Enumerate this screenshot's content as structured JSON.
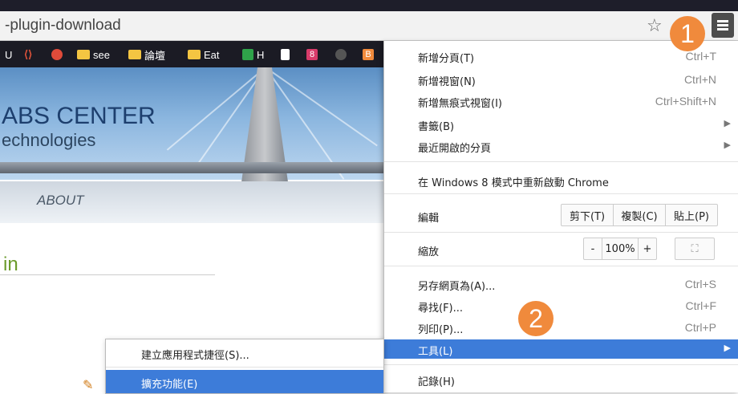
{
  "omnibox": {
    "url": "-plugin-download"
  },
  "bookmarks": [
    {
      "label": "U",
      "color": "#1b1b24"
    },
    {
      "label": "",
      "color": "#e0533a"
    },
    {
      "label": "",
      "color": "#e04b3a"
    },
    {
      "label": "see",
      "color": "#f4c542"
    },
    {
      "label": "論壇",
      "color": "#f4c542"
    },
    {
      "label": "Eat",
      "color": "#f4c542"
    },
    {
      "label": "H",
      "color": "#2fa34a"
    },
    {
      "label": "",
      "color": "#ffffff"
    },
    {
      "label": "8",
      "color": "#d83b6a"
    },
    {
      "label": "",
      "color": "#555555"
    },
    {
      "label": "B",
      "color": "#f08a3c"
    }
  ],
  "site": {
    "title": "ABS CENTER",
    "subtitle": "echnologies",
    "nav_about": "ABOUT",
    "heading": "in"
  },
  "menu": {
    "new_tab": {
      "label": "新增分頁(T)",
      "shortcut": "Ctrl+T"
    },
    "new_window": {
      "label": "新增視窗(N)",
      "shortcut": "Ctrl+N"
    },
    "incognito": {
      "label": "新增無痕式視窗(I)",
      "shortcut": "Ctrl+Shift+N"
    },
    "bookmarks": {
      "label": "書籤(B)"
    },
    "recent": {
      "label": "最近開啟的分頁"
    },
    "relaunch": {
      "label": "在 Windows 8 模式中重新啟動 Chrome"
    },
    "edit": {
      "label": "編輯",
      "cut": "剪下(T)",
      "copy": "複製(C)",
      "paste": "貼上(P)"
    },
    "zoom": {
      "label": "縮放",
      "minus": "-",
      "value": "100%",
      "plus": "+"
    },
    "save_as": {
      "label": "另存網頁為(A)...",
      "shortcut": "Ctrl+S"
    },
    "find": {
      "label": "尋找(F)...",
      "shortcut": "Ctrl+F"
    },
    "print": {
      "label": "列印(P)...",
      "shortcut": "Ctrl+P"
    },
    "tools": {
      "label": "工具(L)"
    },
    "history": {
      "label": "記錄(H)"
    }
  },
  "submenu": {
    "create_shortcut": "建立應用程式捷徑(S)...",
    "extensions": "擴充功能(E)"
  },
  "badges": {
    "one": "1",
    "two": "2"
  },
  "colors": {
    "highlight": "#3d7cd9",
    "badge": "#f08a3c"
  }
}
